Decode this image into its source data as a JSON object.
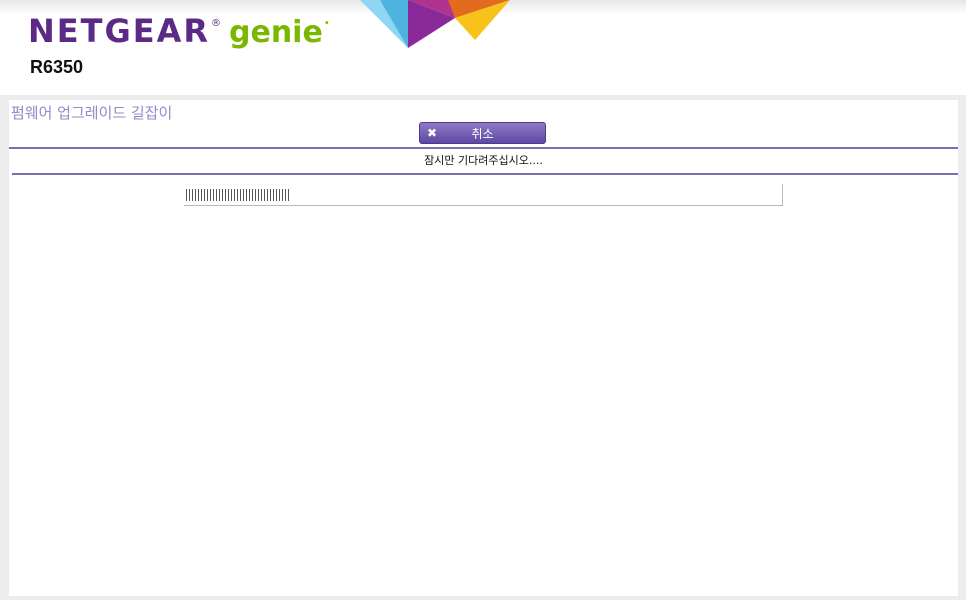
{
  "header": {
    "brand": "NETGEAR",
    "registered_mark": "®",
    "product": "genie",
    "product_mark": "•",
    "model": "R6350"
  },
  "wizard": {
    "title": "펌웨어 업그레이드 길잡이",
    "cancel_label": "취소",
    "cancel_icon_glyph": "✖",
    "wait_message": "잠시만 기다려주십시오....",
    "progress_fraction": 0.175
  },
  "colors": {
    "brand_purple": "#5b2a86",
    "genie_green": "#7ab800",
    "title_lavender": "#9a86c9",
    "divider": "#7a6db5",
    "button": "#6f5ab3"
  },
  "icons": {
    "cancel": "close-icon"
  }
}
